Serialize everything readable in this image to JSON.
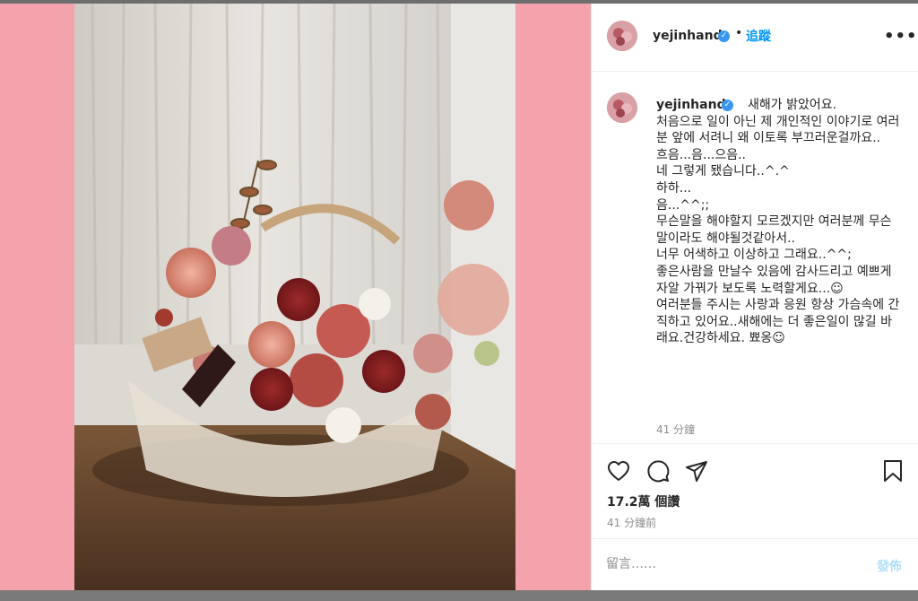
{
  "post": {
    "username": "yejinhand",
    "verified_mark": "✓",
    "dot": "•",
    "follow_label": "追蹤",
    "more_label": "•••",
    "caption_username": "yejinhand",
    "caption_text": "새해가 밝았어요.\n처음으로 일이 아닌 제 개인적인 이야기로 여러분 앞에 서려니 왜 이토록 부끄러운걸까요..\n흐음...음...으음..\n네 그렇게 됐습니다..^.^\n하하...\n음...^^;;\n무슨말을 해야할지 모르겠지만 여러분께 무슨말이라도 해야될것같아서..\n너무 어색하고 이상하고 그래요..^^;\n좋은사람을 만날수 있음에 감사드리고 예쁘게 자알 가꿔가 보도록 노력할게요...☺\n여러분들 주시는 사랑과 응원 항상 가슴속에 간직하고 있어요..새해에는 더 좋은일이 많길 바래요.건강하세요. 뾰옹☺",
    "caption_time": "41 分鐘",
    "views": "17.2萬 個讚",
    "posted_time": "41 分鐘前"
  },
  "comment": {
    "placeholder": "留言……",
    "post_label": "發佈"
  },
  "icons": {
    "like": "heart-icon",
    "comment": "comment-bubble-icon",
    "share": "paper-plane-icon",
    "save": "bookmark-icon",
    "more": "more-options-icon",
    "verified": "verified-badge-icon"
  },
  "colors": {
    "background_pink": "#f4a3ac",
    "link_blue": "#0095f6",
    "verified_blue": "#3897f0",
    "post_disabled": "#b2dffc"
  }
}
